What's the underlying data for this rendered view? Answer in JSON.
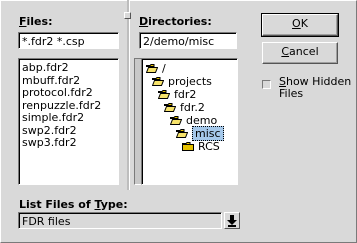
{
  "files": {
    "label": "Files:",
    "label_underline": "F",
    "label_rest": "iles:",
    "filter_value": "*.fdr2 *.csp",
    "items": [
      "abp.fdr2",
      "mbuff.fdr2",
      "protocol.fdr2",
      "renpuzzle.fdr2",
      "simple.fdr2",
      "swp2.fdr2",
      "swp3.fdr2"
    ]
  },
  "directories": {
    "label_underline": "D",
    "label_rest": "irectories:",
    "path_value": "2/demo/misc",
    "tree": [
      {
        "name": "/",
        "icon": "folder-open-icon"
      },
      {
        "name": "projects",
        "icon": "folder-open-icon"
      },
      {
        "name": "fdr2",
        "icon": "folder-open-icon"
      },
      {
        "name": "fdr.2",
        "icon": "folder-open-icon"
      },
      {
        "name": "demo",
        "icon": "folder-open-icon"
      },
      {
        "name": "misc",
        "icon": "folder-open-icon",
        "selected": true
      },
      {
        "name": "RCS",
        "icon": "folder-closed-icon"
      }
    ]
  },
  "buttons": {
    "ok_underline": "O",
    "ok_rest": "K",
    "cancel_underline": "C",
    "cancel_rest": "ancel"
  },
  "show_hidden": {
    "underline": "S",
    "line1_rest": "how Hidden",
    "line2": "Files",
    "checked": false
  },
  "file_type": {
    "label_pre": "List Files of ",
    "label_underline": "T",
    "label_rest": "ype:",
    "selected": "FDR files"
  },
  "colors": {
    "background": "#d9d9d9",
    "selection": "#a5c8ea",
    "folder": "#e6c200"
  }
}
